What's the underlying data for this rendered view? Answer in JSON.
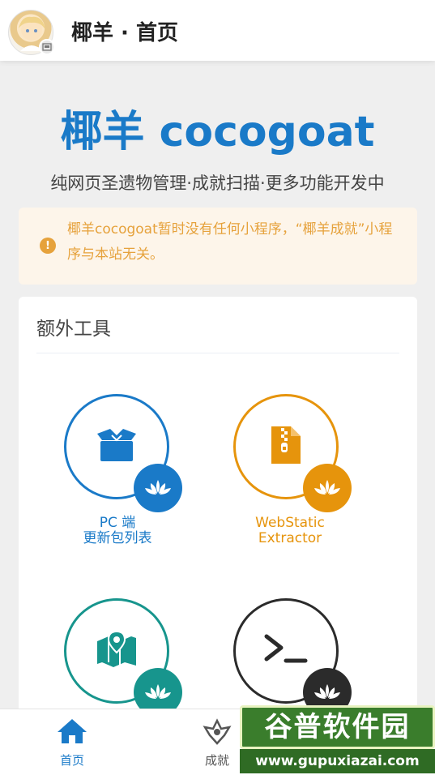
{
  "header": {
    "page_title": "椰羊 · 首页"
  },
  "hero": {
    "title": "椰羊 cocogoat",
    "subtitle": "纯网页圣遗物管理·成就扫描·更多功能开发中"
  },
  "notice": {
    "icon": "exclamation-icon",
    "text": "椰羊cocogoat暂时没有任何小程序，“椰羊成就”小程序与本站无关。",
    "color": "#e6a23c"
  },
  "extra_tools": {
    "title": "额外工具",
    "items": [
      {
        "label_line1": "PC 端",
        "label_line2": "更新包列表",
        "color": "#1a7ac8",
        "icon": "box-icon"
      },
      {
        "label_line1": "WebStatic",
        "label_line2": "Extractor",
        "color": "#e6940c",
        "icon": "zip-file-icon"
      },
      {
        "label_line1": "",
        "label_line2": "",
        "color": "#17958d",
        "icon": "map-icon"
      },
      {
        "label_line1": "",
        "label_line2": "",
        "color": "#2b2b2b",
        "icon": "terminal-icon"
      }
    ]
  },
  "bottom_nav": {
    "items": [
      {
        "label": "首页",
        "icon": "home-icon",
        "active": true,
        "color": "#1a7ac8"
      },
      {
        "label": "成就",
        "icon": "achievement-icon",
        "active": false,
        "color": "#555555"
      }
    ]
  },
  "watermark": {
    "title": "谷普软件园",
    "url": "www.gupuxiazai.com"
  }
}
